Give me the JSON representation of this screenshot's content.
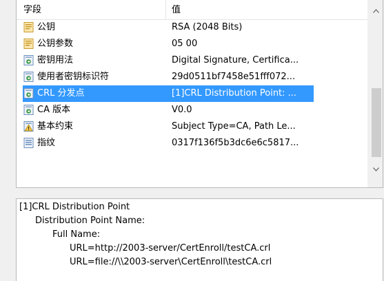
{
  "list": {
    "header": {
      "field_label": "字段",
      "value_label": "值"
    },
    "rows": [
      {
        "icon": "certificate-field-icon",
        "field": "公钥",
        "value": "RSA (2048 Bits)"
      },
      {
        "icon": "certificate-field-icon",
        "field": "公钥参数",
        "value": "05 00"
      },
      {
        "icon": "extension-icon",
        "field": "密钥用法",
        "value": "Digital Signature, Certifica..."
      },
      {
        "icon": "extension-icon",
        "field": "使用者密钥标识符",
        "value": "29d0511bf7458e51fff072..."
      },
      {
        "icon": "extension-icon",
        "field": "CRL 分发点",
        "value": "[1]CRL Distribution Point: ..."
      },
      {
        "icon": "extension-icon",
        "field": "CA 版本",
        "value": "V0.0"
      },
      {
        "icon": "critical-extension-icon",
        "field": "基本约束",
        "value": "Subject Type=CA, Path Le..."
      },
      {
        "icon": "property-icon",
        "field": "指纹",
        "value": "0317f136f5b3dc6e6c5817..."
      }
    ],
    "selected_index": 4
  },
  "scrollbar": {
    "up_arrow": "^",
    "down_arrow": "v"
  },
  "detail": {
    "lines": [
      "[1]CRL Distribution Point",
      "Distribution Point Name:",
      "Full Name:",
      "URL=http://2003-server/CertEnroll/testCA.crl",
      "URL=file://\\\\2003-server\\CertEnroll\\testCA.crl"
    ]
  },
  "colors": {
    "selection": "#3399ff",
    "icon_yellow": "#f2c94c",
    "icon_green": "#3e9a4a",
    "icon_blue": "#6b8fbf"
  }
}
